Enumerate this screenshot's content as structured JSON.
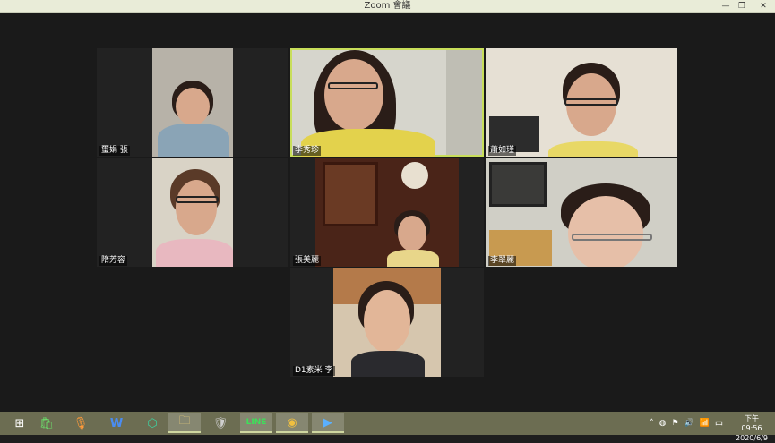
{
  "window": {
    "title": "Zoom 會議",
    "min_label": "—",
    "max_label": "❐",
    "close_label": "✕"
  },
  "participants": [
    {
      "name": "璽娟 張"
    },
    {
      "name": "李秀珍"
    },
    {
      "name": "蕭如瑾"
    },
    {
      "name": "隋芳容"
    },
    {
      "name": "張美麗"
    },
    {
      "name": "李翠麗"
    },
    {
      "name": "D1素米 李"
    }
  ],
  "taskbar": {
    "apps": [
      {
        "icon": "start-icon",
        "label": "⊞"
      },
      {
        "icon": "store-icon",
        "label": "🛍"
      },
      {
        "icon": "mic-icon",
        "label": "🎙"
      },
      {
        "icon": "word-icon",
        "label": "W"
      },
      {
        "icon": "shield-app-icon",
        "label": "⬡"
      },
      {
        "icon": "folder-icon",
        "label": "🗀"
      },
      {
        "icon": "security-icon",
        "label": "🛡"
      },
      {
        "icon": "line-icon",
        "label": "LINE"
      },
      {
        "icon": "chrome-icon",
        "label": "◉"
      },
      {
        "icon": "zoom-icon",
        "label": "▶"
      }
    ],
    "tray": {
      "ime": "中",
      "time": "下午 09:56",
      "date": "2020/6/9"
    }
  },
  "colors": {
    "active_speaker_outline": "#c8de5a",
    "taskbar": "#6c6d52",
    "titlebar": "#e9ecd8"
  }
}
